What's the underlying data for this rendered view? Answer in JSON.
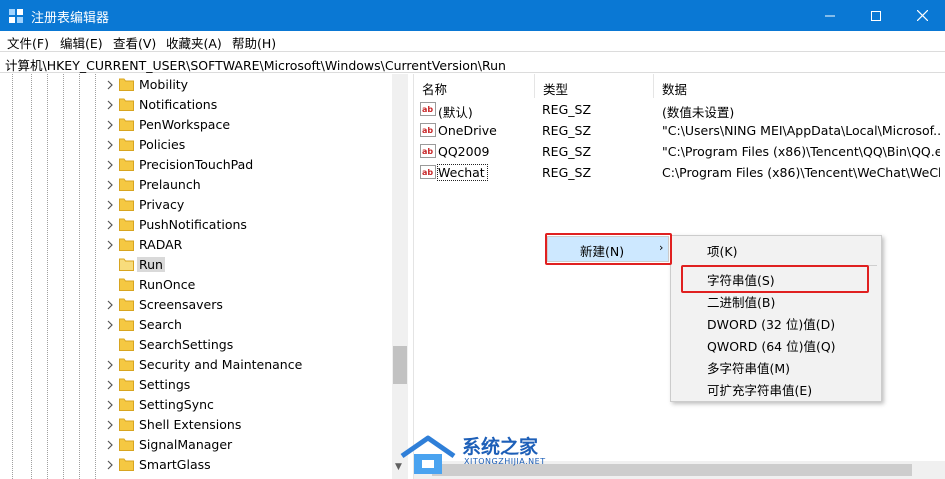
{
  "window": {
    "title": "注册表编辑器",
    "buttons": [
      "minimize",
      "maximize",
      "close"
    ]
  },
  "menu": [
    "文件(F)",
    "编辑(E)",
    "查看(V)",
    "收藏夹(A)",
    "帮助(H)"
  ],
  "address": "计算机\\HKEY_CURRENT_USER\\SOFTWARE\\Microsoft\\Windows\\CurrentVersion\\Run",
  "tree": {
    "items": [
      {
        "label": "Mobility",
        "expandable": true
      },
      {
        "label": "Notifications",
        "expandable": true
      },
      {
        "label": "PenWorkspace",
        "expandable": true
      },
      {
        "label": "Policies",
        "expandable": true
      },
      {
        "label": "PrecisionTouchPad",
        "expandable": true
      },
      {
        "label": "Prelaunch",
        "expandable": true
      },
      {
        "label": "Privacy",
        "expandable": true
      },
      {
        "label": "PushNotifications",
        "expandable": true
      },
      {
        "label": "RADAR",
        "expandable": true
      },
      {
        "label": "Run",
        "expandable": false,
        "selected": true
      },
      {
        "label": "RunOnce",
        "expandable": false
      },
      {
        "label": "Screensavers",
        "expandable": true
      },
      {
        "label": "Search",
        "expandable": true
      },
      {
        "label": "SearchSettings",
        "expandable": false
      },
      {
        "label": "Security and Maintenance",
        "expandable": true
      },
      {
        "label": "Settings",
        "expandable": true
      },
      {
        "label": "SettingSync",
        "expandable": true
      },
      {
        "label": "Shell Extensions",
        "expandable": true
      },
      {
        "label": "SignalManager",
        "expandable": true
      },
      {
        "label": "SmartGlass",
        "expandable": true
      }
    ]
  },
  "list": {
    "columns": [
      "名称",
      "类型",
      "数据"
    ],
    "rows": [
      {
        "name": "(默认)",
        "type": "REG_SZ",
        "data": "(数值未设置)"
      },
      {
        "name": "OneDrive",
        "type": "REG_SZ",
        "data": "\"C:\\Users\\NING MEI\\AppData\\Local\\Microsof..."
      },
      {
        "name": "QQ2009",
        "type": "REG_SZ",
        "data": "\"C:\\Program Files (x86)\\Tencent\\QQ\\Bin\\QQ.e..."
      },
      {
        "name": "Wechat",
        "type": "REG_SZ",
        "data": "C:\\Program Files (x86)\\Tencent\\WeChat\\WeCh..."
      }
    ]
  },
  "context_menu": {
    "new_label": "新建(N)",
    "submenu": [
      "项(K)",
      "字符串值(S)",
      "二进制值(B)",
      "DWORD (32 位)值(D)",
      "QWORD (64 位)值(Q)",
      "多字符串值(M)",
      "可扩充字符串值(E)"
    ]
  },
  "watermark": {
    "text": "系统之家",
    "url": "XITONGZHIJIA.NET"
  },
  "colors": {
    "titlebar": "#0a78d4",
    "highlight_box": "#e02020",
    "menu_hover": "#cde8ff",
    "folder": "#f5c842"
  }
}
